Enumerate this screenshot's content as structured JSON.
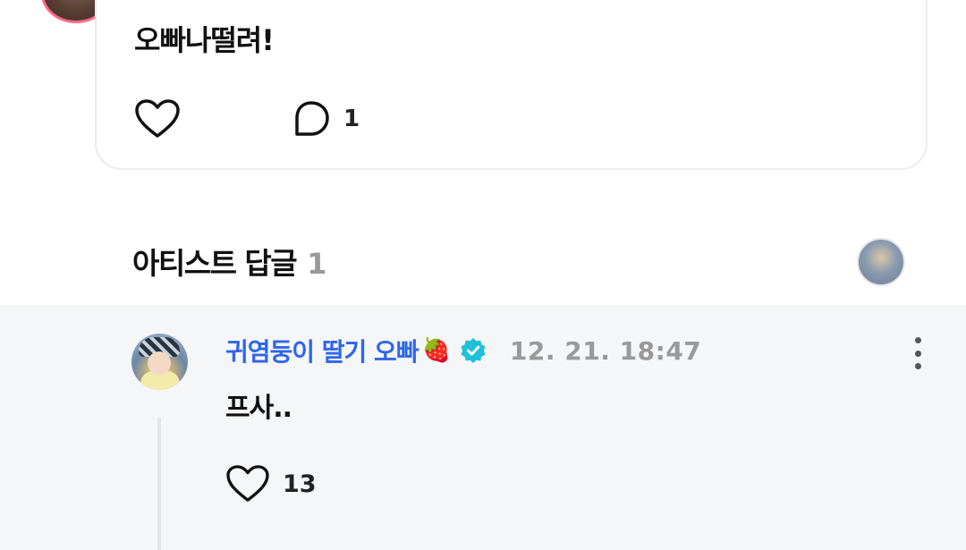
{
  "post": {
    "text": "오빠나떨려!",
    "comment_count": "1",
    "icons": {
      "like": "heart-outline-icon",
      "comment": "comment-bubble-icon"
    }
  },
  "section": {
    "title": "아티스트 답글",
    "count": "1"
  },
  "reply": {
    "author": "귀염둥이 딸기 오빠",
    "author_emoji": "🍓",
    "timestamp": "12. 21. 18:47",
    "text": "프사..",
    "like_count": "13",
    "icons": {
      "verified": "verified-badge-icon",
      "more": "more-vertical-icon",
      "like": "heart-outline-icon"
    }
  },
  "colors": {
    "author_name": "#2f66e8",
    "verified_badge": "#1ec1d8",
    "muted_text": "#999999",
    "reply_background": "#f5f6f8"
  }
}
